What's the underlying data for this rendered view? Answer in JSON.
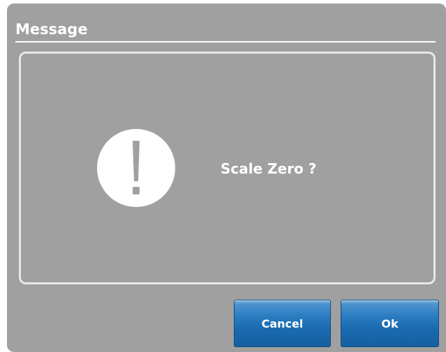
{
  "dialog": {
    "title": "Message",
    "message": "Scale Zero ?",
    "icon": "alert-icon",
    "buttons": {
      "cancel_label": "Cancel",
      "ok_label": "Ok"
    }
  },
  "colors": {
    "dialog_background": "#a0a0a0",
    "text": "#ffffff",
    "button_blue": "#1b6bb0"
  }
}
